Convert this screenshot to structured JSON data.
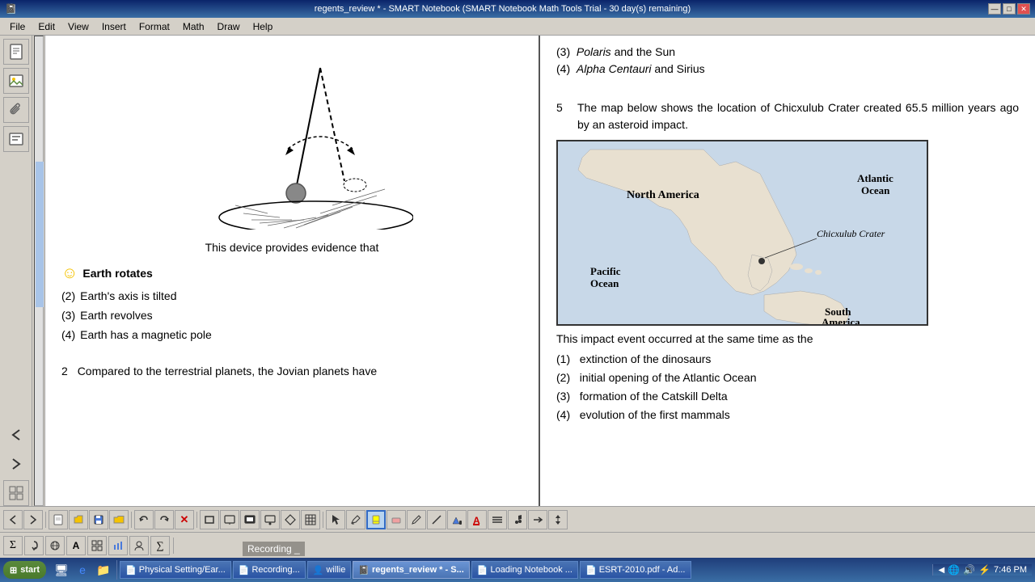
{
  "titlebar": {
    "title": "regents_review * - SMART Notebook (SMART Notebook Math Tools Trial - 30 day(s) remaining)",
    "minimize": "—",
    "maximize": "□",
    "close": "✕"
  },
  "menubar": {
    "items": [
      "File",
      "Edit",
      "View",
      "Insert",
      "Format",
      "Math",
      "Draw",
      "Help"
    ]
  },
  "left_page": {
    "pendulum_caption": "This device provides evidence that",
    "answers": [
      {
        "marker": "😊",
        "text": "Earth rotates",
        "bold": true
      },
      {
        "marker": "(2)",
        "text": "Earth's axis is tilted"
      },
      {
        "marker": "(3)",
        "text": "Earth revolves"
      },
      {
        "marker": "(4)",
        "text": "Earth has a magnetic pole"
      }
    ],
    "q2_number": "2",
    "q2_text": "Compared to the terrestrial planets, the Jovian planets have"
  },
  "right_page": {
    "top_lines": [
      {
        "text": "(3)  Polaris",
        "italic_part": "Polaris",
        "rest": " and the Sun"
      },
      {
        "text": "(4)  Alpha Centauri",
        "italic_part": "Alpha Centauri",
        "rest": " and Sirius"
      }
    ],
    "q5_number": "5",
    "q5_text": "The map below shows the location of Chicxulub Crater created 65.5 million years ago by an asteroid impact.",
    "map_labels": {
      "north_america": "North America",
      "atlantic_ocean": "Atlantic Ocean",
      "pacific_ocean": "Pacific Ocean",
      "chicxulub": "Chicxulub Crater",
      "south_america": "South America"
    },
    "impact_text": "This impact event occurred at the same time as the",
    "impact_answers": [
      {
        "marker": "(1)",
        "text": "extinction of the dinosaurs"
      },
      {
        "marker": "(2)",
        "text": "initial opening of the Atlantic Ocean"
      },
      {
        "marker": "(3)",
        "text": "formation of the Catskill Delta"
      },
      {
        "marker": "(4)",
        "text": "evolution of the first mammals"
      }
    ]
  },
  "toolbar1": {
    "tools": [
      "←",
      "→",
      "📄",
      "🖼",
      "💾",
      "📁",
      "↩",
      "↪",
      "✕",
      "▭",
      "🖥",
      "🖥",
      "🖥",
      "◆",
      "⊞",
      "↖",
      "✏",
      "🖊",
      "✂",
      "📝",
      "🖊",
      "✎",
      "🔍",
      "A",
      "≡",
      "♪",
      "→"
    ]
  },
  "toolbar2": {
    "tools": [
      "Σ",
      "↺",
      "🌐",
      "A",
      "⊞",
      "📊",
      "👤",
      "∑"
    ]
  },
  "taskbar": {
    "start_label": "start",
    "items": [
      {
        "label": "Physical Setting/Ear...",
        "icon": "📄"
      },
      {
        "label": "Recording...",
        "icon": "📄"
      },
      {
        "label": "willie",
        "icon": "👤"
      },
      {
        "label": "regents_review * - S...",
        "icon": "📄",
        "active": true
      },
      {
        "label": "Loading Notebook ...",
        "icon": "📄"
      },
      {
        "label": "ESRT-2010.pdf - Ad...",
        "icon": "📄"
      }
    ],
    "tray": {
      "time": "7:46 PM",
      "icons": [
        "🔊",
        "🌐",
        "💻"
      ]
    }
  },
  "recording_text": "Recording _"
}
